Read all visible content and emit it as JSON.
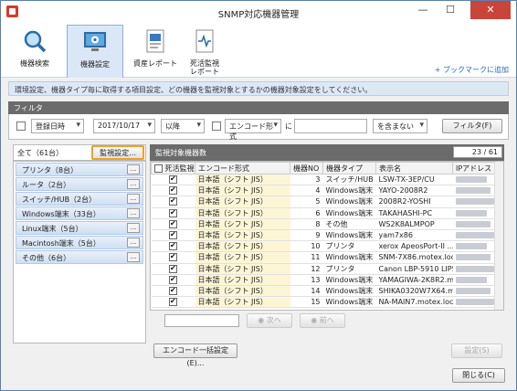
{
  "window": {
    "title": "SNMP対応機器管理",
    "minimize": "—",
    "maximize": "☐",
    "close": "✕"
  },
  "ribbon": {
    "tabs": [
      {
        "label": "機器検索",
        "icon": "magnifier-icon"
      },
      {
        "label": "機器設定",
        "icon": "monitor-gear-icon",
        "active": true
      },
      {
        "label": "資産レポート",
        "icon": "report-icon"
      },
      {
        "label": "死活監視\nレポート",
        "icon": "health-report-icon"
      }
    ],
    "bookmark": "+ ブックマークに追加"
  },
  "info_text": "環境設定、機器タイプ毎に取得する項目設定、どの機器を監視対象とするかの機器対象設定をしてください。",
  "filter": {
    "header": "フィルタ",
    "date_field": "登録日時",
    "date_value": "2017/10/17",
    "date_op": "以降",
    "encode_field": "エンコード形式",
    "ni": "に",
    "contains": "を含まない",
    "apply_button": "フィルタ(F)"
  },
  "left": {
    "all_label": "全て（61台）",
    "monitor_settings_button": "監視設定...",
    "categories": [
      "プリンタ（8台）",
      "ルータ（2台）",
      "スイッチ/HUB（2台）",
      "Windows端末（33台）",
      "Linux端末（5台）",
      "Macintosh端末（5台）",
      "その他（6台）"
    ],
    "more": "..."
  },
  "right": {
    "header": "監視対象機器数",
    "count": "23 / 61",
    "columns": [
      "死活監視",
      "エンコード形式",
      "機器NO",
      "機器タイプ",
      "表示名",
      "IPアドレス"
    ],
    "rows": [
      {
        "checked": true,
        "encode": "日本語（シフト JIS）",
        "no": "3",
        "type": "スイッチ/HUB",
        "name": "LSW-TX-3EP/CU"
      },
      {
        "checked": true,
        "encode": "日本語（シフト JIS）",
        "no": "4",
        "type": "Windows端末",
        "name": "YAYO-2008R2"
      },
      {
        "checked": true,
        "encode": "日本語（シフト JIS）",
        "no": "5",
        "type": "Windows端末",
        "name": "2008R2-YOSHI"
      },
      {
        "checked": true,
        "encode": "日本語（シフト JIS）",
        "no": "6",
        "type": "Windows端末",
        "name": "TAKAHASHI-PC"
      },
      {
        "checked": true,
        "encode": "日本語（シフト JIS）",
        "no": "8",
        "type": "その他",
        "name": "WS2K8ALMPOP"
      },
      {
        "checked": true,
        "encode": "日本語（シフト JIS）",
        "no": "9",
        "type": "Windows端末",
        "name": "yam7x86"
      },
      {
        "checked": true,
        "encode": "日本語（シフト JIS）",
        "no": "10",
        "type": "プリンタ",
        "name": "xerox ApeosPort-II ..."
      },
      {
        "checked": true,
        "encode": "日本語（シフト JIS）",
        "no": "11",
        "type": "Windows端末",
        "name": "SNM-7X86.motex.local"
      },
      {
        "checked": true,
        "encode": "日本語（シフト JIS）",
        "no": "12",
        "type": "プリンタ",
        "name": "Canon LBP-5910 LIPS4"
      },
      {
        "checked": true,
        "encode": "日本語（シフト JIS）",
        "no": "13",
        "type": "Windows端末",
        "name": "YAMAGIWA-2K8R2.m..."
      },
      {
        "checked": true,
        "encode": "日本語（シフト JIS）",
        "no": "14",
        "type": "Windows端末",
        "name": "SHIKA0320W7X64.m..."
      },
      {
        "checked": true,
        "encode": "日本語（シフト JIS）",
        "no": "15",
        "type": "Windows端末",
        "name": "NA-MAIN7.motex.local"
      }
    ],
    "next_button": "次へ",
    "prev_button": "前へ",
    "encode_bulk_button": "エンコード一括設定(E)...",
    "settings_button": "設定(S)"
  },
  "close_button": "閉じる(C)"
}
